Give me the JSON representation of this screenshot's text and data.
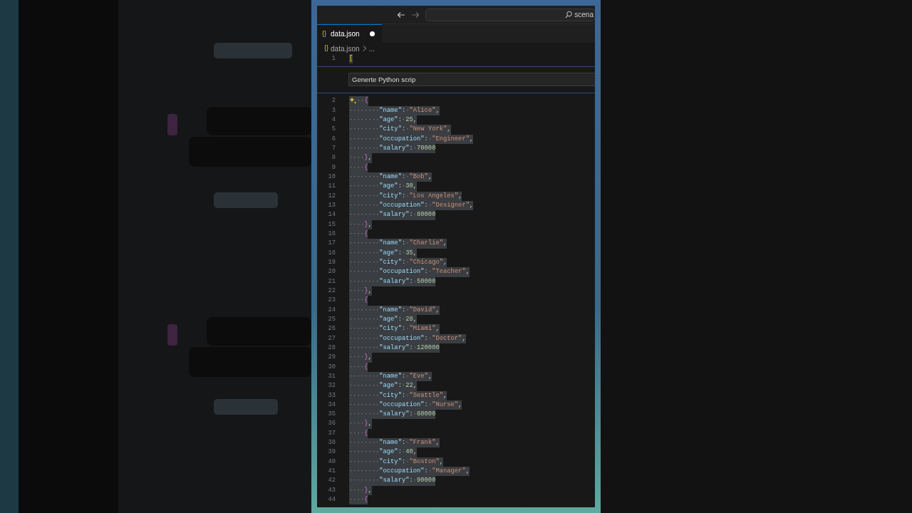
{
  "title_bar": {
    "search_text": "scena"
  },
  "tab": {
    "icon_text": "{}",
    "label": "data.json",
    "modified": true,
    "selected": true
  },
  "breadcrumb": {
    "icon_text": "{}",
    "items": [
      "data.json",
      "..."
    ]
  },
  "inline_chat": {
    "value": "Generte Python scrip"
  },
  "editor_lines": [
    {
      "number": "1",
      "selected": true,
      "tokens": [
        {
          "kind": "bracket1",
          "text": "["
        }
      ]
    },
    {
      "number": "2",
      "selected": true,
      "sparkle": true,
      "tokens": [
        {
          "kind": "space",
          "text": "··"
        },
        {
          "kind": "bracket2",
          "text": "{"
        }
      ]
    },
    {
      "number": "3",
      "selected": true,
      "tokens": [
        {
          "kind": "space",
          "text": "········"
        },
        {
          "kind": "key",
          "text": "\"name\""
        },
        {
          "kind": "punct",
          "text": ":"
        },
        {
          "kind": "space",
          "text": "·"
        },
        {
          "kind": "string",
          "text": "\"Alice\""
        },
        {
          "kind": "punct",
          "text": ","
        }
      ]
    },
    {
      "number": "4",
      "selected": true,
      "tokens": [
        {
          "kind": "space",
          "text": "········"
        },
        {
          "kind": "key",
          "text": "\"age\""
        },
        {
          "kind": "punct",
          "text": ":"
        },
        {
          "kind": "space",
          "text": "·"
        },
        {
          "kind": "number",
          "text": "25"
        },
        {
          "kind": "punct",
          "text": ","
        }
      ]
    },
    {
      "number": "5",
      "selected": true,
      "tokens": [
        {
          "kind": "space",
          "text": "········"
        },
        {
          "kind": "key",
          "text": "\"city\""
        },
        {
          "kind": "punct",
          "text": ":"
        },
        {
          "kind": "space",
          "text": "·"
        },
        {
          "kind": "string",
          "text": "\"New York\""
        },
        {
          "kind": "punct",
          "text": ","
        }
      ]
    },
    {
      "number": "6",
      "selected": true,
      "tokens": [
        {
          "kind": "space",
          "text": "········"
        },
        {
          "kind": "key",
          "text": "\"occupation\""
        },
        {
          "kind": "punct",
          "text": ":"
        },
        {
          "kind": "space",
          "text": "·"
        },
        {
          "kind": "string",
          "text": "\"Engineer\""
        },
        {
          "kind": "punct",
          "text": ","
        }
      ]
    },
    {
      "number": "7",
      "selected": true,
      "tokens": [
        {
          "kind": "space",
          "text": "········"
        },
        {
          "kind": "key",
          "text": "\"salary\""
        },
        {
          "kind": "punct",
          "text": ":"
        },
        {
          "kind": "space",
          "text": "·"
        },
        {
          "kind": "number",
          "text": "70000"
        }
      ]
    },
    {
      "number": "8",
      "selected": true,
      "tokens": [
        {
          "kind": "space",
          "text": "····"
        },
        {
          "kind": "bracket2",
          "text": "}"
        },
        {
          "kind": "punct",
          "text": ","
        }
      ]
    },
    {
      "number": "9",
      "selected": true,
      "tokens": [
        {
          "kind": "space",
          "text": "····"
        },
        {
          "kind": "bracket2",
          "text": "{"
        }
      ]
    },
    {
      "number": "10",
      "selected": true,
      "tokens": [
        {
          "kind": "space",
          "text": "········"
        },
        {
          "kind": "key",
          "text": "\"name\""
        },
        {
          "kind": "punct",
          "text": ":"
        },
        {
          "kind": "space",
          "text": "·"
        },
        {
          "kind": "string",
          "text": "\"Bob\""
        },
        {
          "kind": "punct",
          "text": ","
        }
      ]
    },
    {
      "number": "11",
      "selected": true,
      "tokens": [
        {
          "kind": "space",
          "text": "········"
        },
        {
          "kind": "key",
          "text": "\"age\""
        },
        {
          "kind": "punct",
          "text": ":"
        },
        {
          "kind": "space",
          "text": "·"
        },
        {
          "kind": "number",
          "text": "30"
        },
        {
          "kind": "punct",
          "text": ","
        }
      ]
    },
    {
      "number": "12",
      "selected": true,
      "tokens": [
        {
          "kind": "space",
          "text": "········"
        },
        {
          "kind": "key",
          "text": "\"city\""
        },
        {
          "kind": "punct",
          "text": ":"
        },
        {
          "kind": "space",
          "text": "·"
        },
        {
          "kind": "string",
          "text": "\"Los Angeles\""
        },
        {
          "kind": "punct",
          "text": ","
        }
      ]
    },
    {
      "number": "13",
      "selected": true,
      "tokens": [
        {
          "kind": "space",
          "text": "········"
        },
        {
          "kind": "key",
          "text": "\"occupation\""
        },
        {
          "kind": "punct",
          "text": ":"
        },
        {
          "kind": "space",
          "text": "·"
        },
        {
          "kind": "string",
          "text": "\"Designer\""
        },
        {
          "kind": "punct",
          "text": ","
        }
      ]
    },
    {
      "number": "14",
      "selected": true,
      "tokens": [
        {
          "kind": "space",
          "text": "········"
        },
        {
          "kind": "key",
          "text": "\"salary\""
        },
        {
          "kind": "punct",
          "text": ":"
        },
        {
          "kind": "space",
          "text": "·"
        },
        {
          "kind": "number",
          "text": "80000"
        }
      ]
    },
    {
      "number": "15",
      "selected": true,
      "tokens": [
        {
          "kind": "space",
          "text": "····"
        },
        {
          "kind": "bracket2",
          "text": "}"
        },
        {
          "kind": "punct",
          "text": ","
        }
      ]
    },
    {
      "number": "16",
      "selected": true,
      "tokens": [
        {
          "kind": "space",
          "text": "····"
        },
        {
          "kind": "bracket2",
          "text": "{"
        }
      ]
    },
    {
      "number": "17",
      "selected": true,
      "tokens": [
        {
          "kind": "space",
          "text": "········"
        },
        {
          "kind": "key",
          "text": "\"name\""
        },
        {
          "kind": "punct",
          "text": ":"
        },
        {
          "kind": "space",
          "text": "·"
        },
        {
          "kind": "string",
          "text": "\"Charlie\""
        },
        {
          "kind": "punct",
          "text": ","
        }
      ]
    },
    {
      "number": "18",
      "selected": true,
      "tokens": [
        {
          "kind": "space",
          "text": "········"
        },
        {
          "kind": "key",
          "text": "\"age\""
        },
        {
          "kind": "punct",
          "text": ":"
        },
        {
          "kind": "space",
          "text": "·"
        },
        {
          "kind": "number",
          "text": "35"
        },
        {
          "kind": "punct",
          "text": ","
        }
      ]
    },
    {
      "number": "19",
      "selected": true,
      "tokens": [
        {
          "kind": "space",
          "text": "········"
        },
        {
          "kind": "key",
          "text": "\"city\""
        },
        {
          "kind": "punct",
          "text": ":"
        },
        {
          "kind": "space",
          "text": "·"
        },
        {
          "kind": "string",
          "text": "\"Chicago\""
        },
        {
          "kind": "punct",
          "text": ","
        }
      ]
    },
    {
      "number": "20",
      "selected": true,
      "tokens": [
        {
          "kind": "space",
          "text": "········"
        },
        {
          "kind": "key",
          "text": "\"occupation\""
        },
        {
          "kind": "punct",
          "text": ":"
        },
        {
          "kind": "space",
          "text": "·"
        },
        {
          "kind": "string",
          "text": "\"Teacher\""
        },
        {
          "kind": "punct",
          "text": ","
        }
      ]
    },
    {
      "number": "21",
      "selected": true,
      "tokens": [
        {
          "kind": "space",
          "text": "········"
        },
        {
          "kind": "key",
          "text": "\"salary\""
        },
        {
          "kind": "punct",
          "text": ":"
        },
        {
          "kind": "space",
          "text": "·"
        },
        {
          "kind": "number",
          "text": "50000"
        }
      ]
    },
    {
      "number": "22",
      "selected": true,
      "tokens": [
        {
          "kind": "space",
          "text": "····"
        },
        {
          "kind": "bracket2",
          "text": "}"
        },
        {
          "kind": "punct",
          "text": ","
        }
      ]
    },
    {
      "number": "23",
      "selected": true,
      "tokens": [
        {
          "kind": "space",
          "text": "····"
        },
        {
          "kind": "bracket2",
          "text": "{"
        }
      ]
    },
    {
      "number": "24",
      "selected": true,
      "tokens": [
        {
          "kind": "space",
          "text": "········"
        },
        {
          "kind": "key",
          "text": "\"name\""
        },
        {
          "kind": "punct",
          "text": ":"
        },
        {
          "kind": "space",
          "text": "·"
        },
        {
          "kind": "string",
          "text": "\"David\""
        },
        {
          "kind": "punct",
          "text": ","
        }
      ]
    },
    {
      "number": "25",
      "selected": true,
      "tokens": [
        {
          "kind": "space",
          "text": "········"
        },
        {
          "kind": "key",
          "text": "\"age\""
        },
        {
          "kind": "punct",
          "text": ":"
        },
        {
          "kind": "space",
          "text": "·"
        },
        {
          "kind": "number",
          "text": "28"
        },
        {
          "kind": "punct",
          "text": ","
        }
      ]
    },
    {
      "number": "26",
      "selected": true,
      "tokens": [
        {
          "kind": "space",
          "text": "········"
        },
        {
          "kind": "key",
          "text": "\"city\""
        },
        {
          "kind": "punct",
          "text": ":"
        },
        {
          "kind": "space",
          "text": "·"
        },
        {
          "kind": "string",
          "text": "\"Miami\""
        },
        {
          "kind": "punct",
          "text": ","
        }
      ]
    },
    {
      "number": "27",
      "selected": true,
      "tokens": [
        {
          "kind": "space",
          "text": "········"
        },
        {
          "kind": "key",
          "text": "\"occupation\""
        },
        {
          "kind": "punct",
          "text": ":"
        },
        {
          "kind": "space",
          "text": "·"
        },
        {
          "kind": "string",
          "text": "\"Doctor\""
        },
        {
          "kind": "punct",
          "text": ","
        }
      ]
    },
    {
      "number": "28",
      "selected": true,
      "tokens": [
        {
          "kind": "space",
          "text": "········"
        },
        {
          "kind": "key",
          "text": "\"salary\""
        },
        {
          "kind": "punct",
          "text": ":"
        },
        {
          "kind": "space",
          "text": "·"
        },
        {
          "kind": "number",
          "text": "120000"
        }
      ]
    },
    {
      "number": "29",
      "selected": true,
      "tokens": [
        {
          "kind": "space",
          "text": "····"
        },
        {
          "kind": "bracket2",
          "text": "}"
        },
        {
          "kind": "punct",
          "text": ","
        }
      ]
    },
    {
      "number": "30",
      "selected": true,
      "tokens": [
        {
          "kind": "space",
          "text": "····"
        },
        {
          "kind": "bracket2",
          "text": "{"
        }
      ]
    },
    {
      "number": "31",
      "selected": true,
      "tokens": [
        {
          "kind": "space",
          "text": "········"
        },
        {
          "kind": "key",
          "text": "\"name\""
        },
        {
          "kind": "punct",
          "text": ":"
        },
        {
          "kind": "space",
          "text": "·"
        },
        {
          "kind": "string",
          "text": "\"Eve\""
        },
        {
          "kind": "punct",
          "text": ","
        }
      ]
    },
    {
      "number": "32",
      "selected": true,
      "tokens": [
        {
          "kind": "space",
          "text": "········"
        },
        {
          "kind": "key",
          "text": "\"age\""
        },
        {
          "kind": "punct",
          "text": ":"
        },
        {
          "kind": "space",
          "text": "·"
        },
        {
          "kind": "number",
          "text": "22"
        },
        {
          "kind": "punct",
          "text": ","
        }
      ]
    },
    {
      "number": "33",
      "selected": true,
      "tokens": [
        {
          "kind": "space",
          "text": "········"
        },
        {
          "kind": "key",
          "text": "\"city\""
        },
        {
          "kind": "punct",
          "text": ":"
        },
        {
          "kind": "space",
          "text": "·"
        },
        {
          "kind": "string",
          "text": "\"Seattle\""
        },
        {
          "kind": "punct",
          "text": ","
        }
      ]
    },
    {
      "number": "34",
      "selected": true,
      "tokens": [
        {
          "kind": "space",
          "text": "········"
        },
        {
          "kind": "key",
          "text": "\"occupation\""
        },
        {
          "kind": "punct",
          "text": ":"
        },
        {
          "kind": "space",
          "text": "·"
        },
        {
          "kind": "string",
          "text": "\"Nurse\""
        },
        {
          "kind": "punct",
          "text": ","
        }
      ]
    },
    {
      "number": "35",
      "selected": true,
      "tokens": [
        {
          "kind": "space",
          "text": "········"
        },
        {
          "kind": "key",
          "text": "\"salary\""
        },
        {
          "kind": "punct",
          "text": ":"
        },
        {
          "kind": "space",
          "text": "·"
        },
        {
          "kind": "number",
          "text": "60000"
        }
      ]
    },
    {
      "number": "36",
      "selected": true,
      "tokens": [
        {
          "kind": "space",
          "text": "····"
        },
        {
          "kind": "bracket2",
          "text": "}"
        },
        {
          "kind": "punct",
          "text": ","
        }
      ]
    },
    {
      "number": "37",
      "selected": true,
      "tokens": [
        {
          "kind": "space",
          "text": "····"
        },
        {
          "kind": "bracket2",
          "text": "{"
        }
      ]
    },
    {
      "number": "38",
      "selected": true,
      "tokens": [
        {
          "kind": "space",
          "text": "········"
        },
        {
          "kind": "key",
          "text": "\"name\""
        },
        {
          "kind": "punct",
          "text": ":"
        },
        {
          "kind": "space",
          "text": "·"
        },
        {
          "kind": "string",
          "text": "\"Frank\""
        },
        {
          "kind": "punct",
          "text": ","
        }
      ]
    },
    {
      "number": "39",
      "selected": true,
      "tokens": [
        {
          "kind": "space",
          "text": "········"
        },
        {
          "kind": "key",
          "text": "\"age\""
        },
        {
          "kind": "punct",
          "text": ":"
        },
        {
          "kind": "space",
          "text": "·"
        },
        {
          "kind": "number",
          "text": "40"
        },
        {
          "kind": "punct",
          "text": ","
        }
      ]
    },
    {
      "number": "40",
      "selected": true,
      "tokens": [
        {
          "kind": "space",
          "text": "········"
        },
        {
          "kind": "key",
          "text": "\"city\""
        },
        {
          "kind": "punct",
          "text": ":"
        },
        {
          "kind": "space",
          "text": "·"
        },
        {
          "kind": "string",
          "text": "\"Boston\""
        },
        {
          "kind": "punct",
          "text": ","
        }
      ]
    },
    {
      "number": "41",
      "selected": true,
      "tokens": [
        {
          "kind": "space",
          "text": "········"
        },
        {
          "kind": "key",
          "text": "\"occupation\""
        },
        {
          "kind": "punct",
          "text": ":"
        },
        {
          "kind": "space",
          "text": "·"
        },
        {
          "kind": "string",
          "text": "\"Manager\""
        },
        {
          "kind": "punct",
          "text": ","
        }
      ]
    },
    {
      "number": "42",
      "selected": true,
      "tokens": [
        {
          "kind": "space",
          "text": "········"
        },
        {
          "kind": "key",
          "text": "\"salary\""
        },
        {
          "kind": "punct",
          "text": ":"
        },
        {
          "kind": "space",
          "text": "·"
        },
        {
          "kind": "number",
          "text": "90000"
        }
      ]
    },
    {
      "number": "43",
      "selected": true,
      "tokens": [
        {
          "kind": "space",
          "text": "····"
        },
        {
          "kind": "bracket2",
          "text": "}"
        },
        {
          "kind": "punct",
          "text": ","
        }
      ]
    },
    {
      "number": "44",
      "selected": true,
      "tokens": [
        {
          "kind": "space",
          "text": "····"
        },
        {
          "kind": "bracket2",
          "text": "{"
        }
      ]
    }
  ]
}
